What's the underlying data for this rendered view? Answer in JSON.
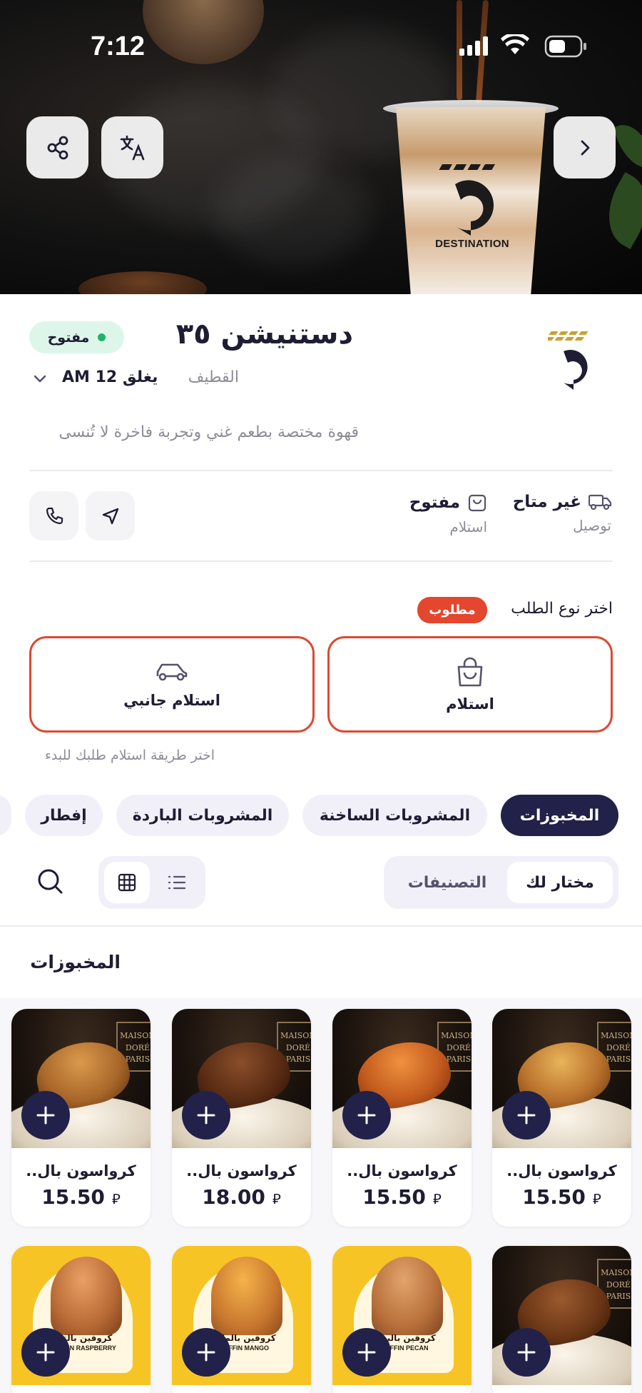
{
  "status_bar": {
    "time": "7:12"
  },
  "hero": {
    "cup_brand": "DESTINATION"
  },
  "store": {
    "name": "دستنيشن ٣٥",
    "open_badge": "مفتوح",
    "city": "القطيف",
    "closes": "يغلق 12 AM",
    "description": "قهوة مختصة بطعم غني وتجربة فاخرة لا تُنسى"
  },
  "services": {
    "delivery": {
      "status": "غير متاح",
      "label": "توصيل"
    },
    "pickup": {
      "status": "مفتوح",
      "label": "استلام"
    }
  },
  "order_type": {
    "label": "اختر نوع الطلب",
    "required": "مطلوب",
    "options": [
      {
        "label": "استلام",
        "icon": "shopping-bag-icon"
      },
      {
        "label": "استلام جانبي",
        "icon": "car-icon"
      }
    ],
    "hint": "اختر طريقة استلام طلبك للبدء"
  },
  "categories": [
    "المخبوزات",
    "المشروبات الساخنة",
    "المشروبات الباردة",
    "إفطار"
  ],
  "tabs": {
    "featured": "مختار لك",
    "categories": "التصنيفات"
  },
  "section": {
    "title": "المخبوزات"
  },
  "currency_symbol": "⃁",
  "products": [
    {
      "name": "كرواسون بال..",
      "price": "15.50"
    },
    {
      "name": "كرواسون بال..",
      "price": "15.50"
    },
    {
      "name": "كرواسون بال..",
      "price": "18.00"
    },
    {
      "name": "كرواسون بال..",
      "price": "15.50"
    }
  ],
  "products_row2": [
    {
      "label": "كروفين بالبيكان",
      "sub": "CROFFIN PECAN"
    },
    {
      "label": "كروفين بالمانجو",
      "sub": "CROFFIN MANGO"
    },
    {
      "label": "كروفين بالتوت",
      "sub": "CROFFIN RASPBERRY"
    }
  ],
  "brand_text": "MAISON DORÉ PARIS",
  "colors": {
    "accent": "#22214a",
    "required": "#e4462e",
    "border_red": "#db4a32",
    "open_green": "#1fb46b"
  }
}
